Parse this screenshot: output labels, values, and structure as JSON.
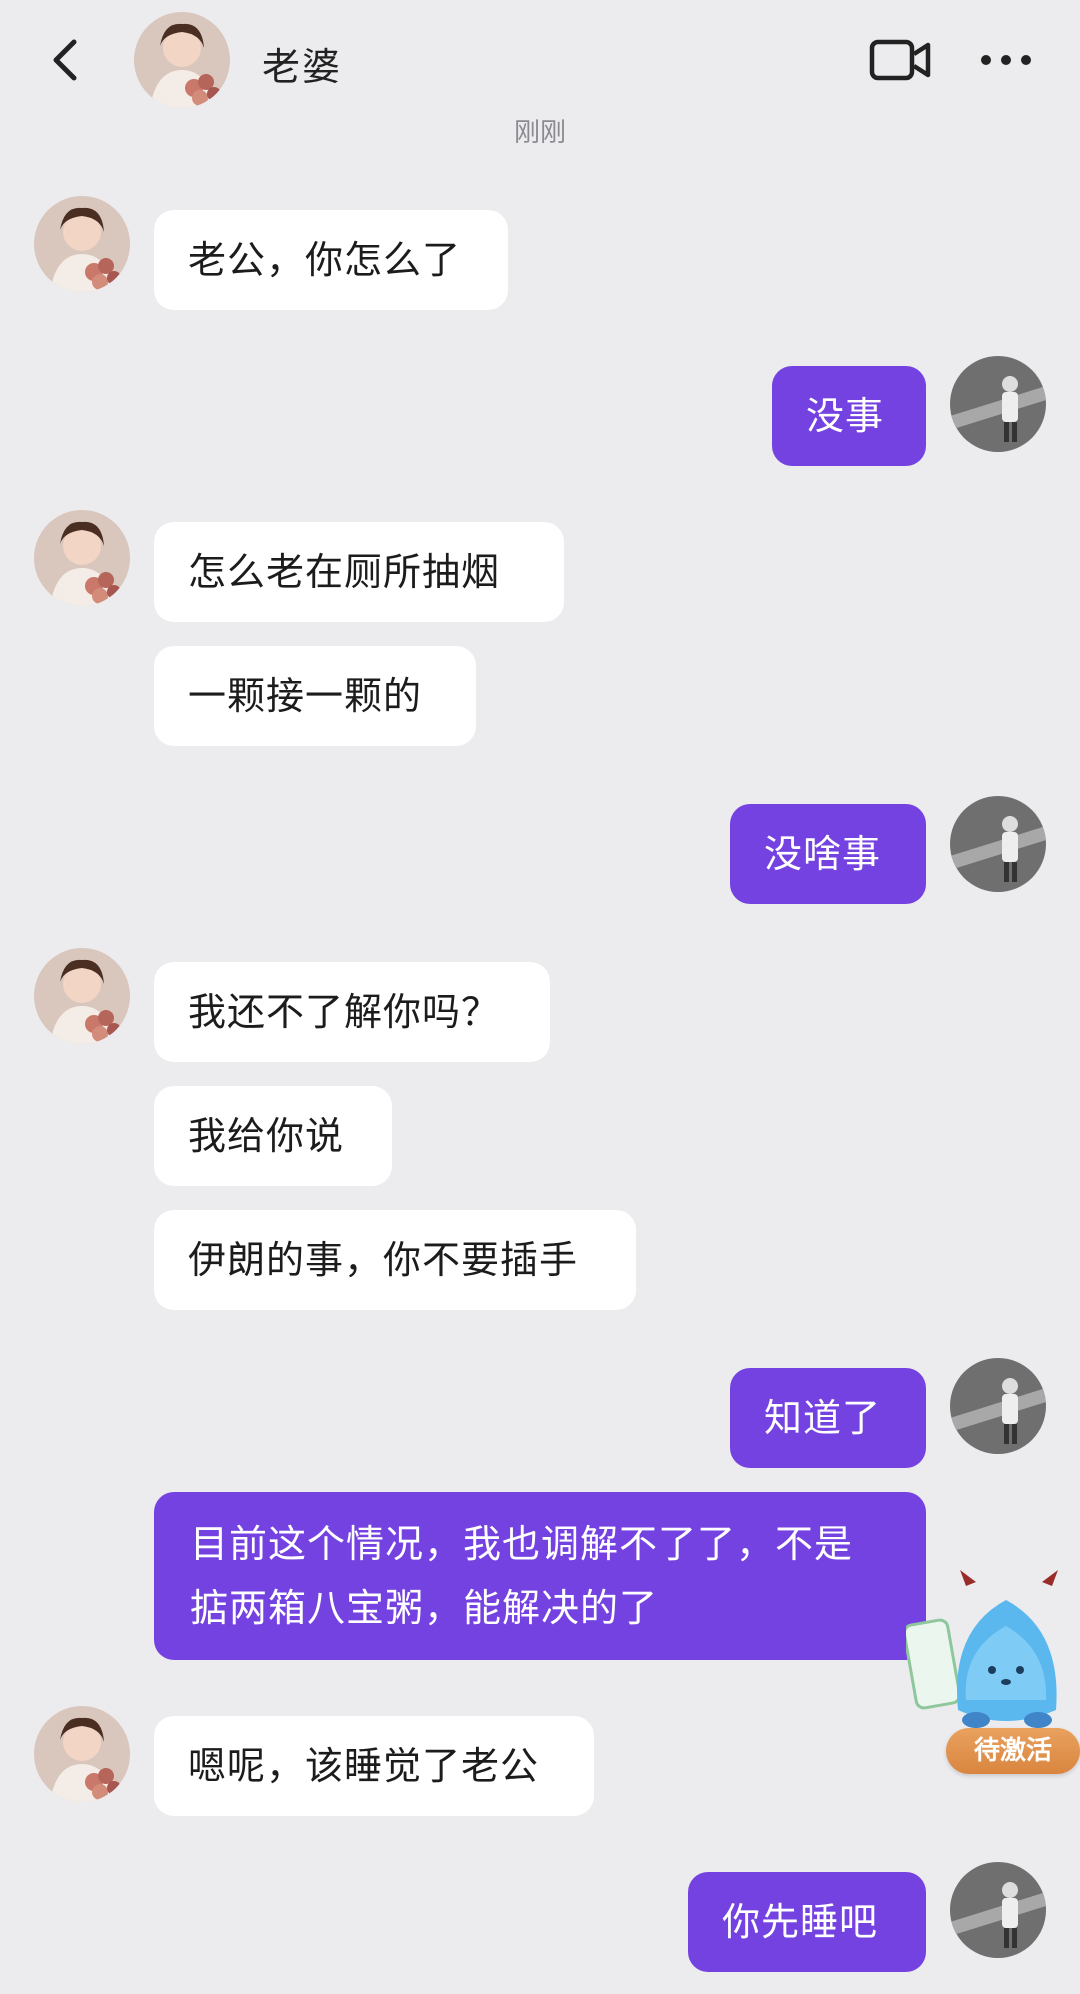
{
  "header": {
    "title": "老婆",
    "timestamp": "刚刚",
    "video_icon": "video-call-icon",
    "more_icon": "more-icon",
    "back_icon": "back-arrow-icon"
  },
  "messages": [
    {
      "side": "in",
      "text": "老公，你怎么了"
    },
    {
      "side": "out",
      "text": "没事"
    },
    {
      "side": "in",
      "text": "怎么老在厕所抽烟"
    },
    {
      "side": "in",
      "text": "一颗接一颗的"
    },
    {
      "side": "out",
      "text": "没啥事"
    },
    {
      "side": "in",
      "text": "我还不了解你吗？"
    },
    {
      "side": "in",
      "text": "我给你说"
    },
    {
      "side": "in",
      "text": "伊朗的事，你不要插手"
    },
    {
      "side": "out",
      "text": "知道了"
    },
    {
      "side": "out",
      "text": "目前这个情况，我也调解不了了，不是 掂两箱八宝粥，能解决的了"
    },
    {
      "side": "in",
      "text": "嗯呢，该睡觉了老公"
    },
    {
      "side": "out",
      "text": "你先睡吧"
    }
  ],
  "widget": {
    "badge": "待激活"
  },
  "colors": {
    "outgoing_bubble": "#7542e2",
    "incoming_bubble": "#ffffff",
    "background": "#ececef"
  }
}
